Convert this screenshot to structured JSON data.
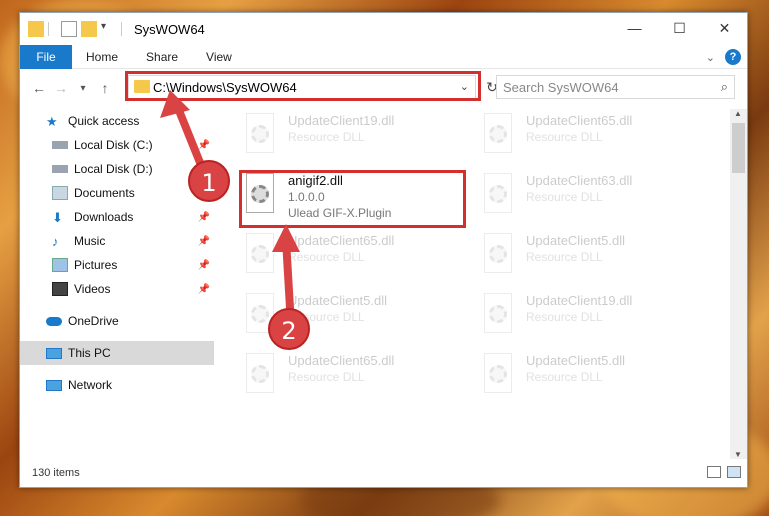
{
  "window": {
    "title": "SysWOW64",
    "controls": [
      "—",
      "☐",
      "✕"
    ]
  },
  "ribbon": {
    "tabs": [
      "File",
      "Home",
      "Share",
      "View"
    ]
  },
  "nav": {
    "address": "C:\\Windows\\SysWOW64",
    "search_placeholder": "Search SysWOW64"
  },
  "sidebar": {
    "items": [
      {
        "label": "Quick access",
        "icon": "star-icon"
      },
      {
        "label": "Local Disk (C:)",
        "icon": "drive-icon"
      },
      {
        "label": "Local Disk (D:)",
        "icon": "drive-icon"
      },
      {
        "label": "Documents",
        "icon": "documents-icon"
      },
      {
        "label": "Downloads",
        "icon": "download-icon"
      },
      {
        "label": "Music",
        "icon": "music-icon"
      },
      {
        "label": "Pictures",
        "icon": "pictures-icon"
      },
      {
        "label": "Videos",
        "icon": "videos-icon"
      },
      {
        "label": "OneDrive",
        "icon": "cloud-icon"
      },
      {
        "label": "This PC",
        "icon": "pc-icon"
      },
      {
        "label": "Network",
        "icon": "network-icon"
      }
    ]
  },
  "files": {
    "highlight": {
      "name": "anigif2.dll",
      "version": "1.0.0.0",
      "desc": "Ulead GIF-X.Plugin"
    },
    "left": [
      {
        "name": "UpdateClient19.dll",
        "desc": "Resource DLL"
      },
      {
        "name": "UpdateClient65.dll",
        "desc": "Resource DLL"
      },
      {
        "name": "UpdateClient5.dll",
        "desc": "Resource DLL"
      },
      {
        "name": "UpdateClient65.dll",
        "desc": "Resource DLL"
      }
    ],
    "right": [
      {
        "name": "UpdateClient65.dll",
        "desc": "Resource DLL"
      },
      {
        "name": "UpdateClient63.dll",
        "desc": "Resource DLL"
      },
      {
        "name": "UpdateClient5.dll",
        "desc": "Resource DLL"
      },
      {
        "name": "UpdateClient19.dll",
        "desc": "Resource DLL"
      },
      {
        "name": "UpdateClient5.dll",
        "desc": "Resource DLL"
      }
    ]
  },
  "status": {
    "item_count": "130 items"
  },
  "annotations": {
    "step1": "1",
    "step2": "2",
    "color": "#d32f2f"
  }
}
